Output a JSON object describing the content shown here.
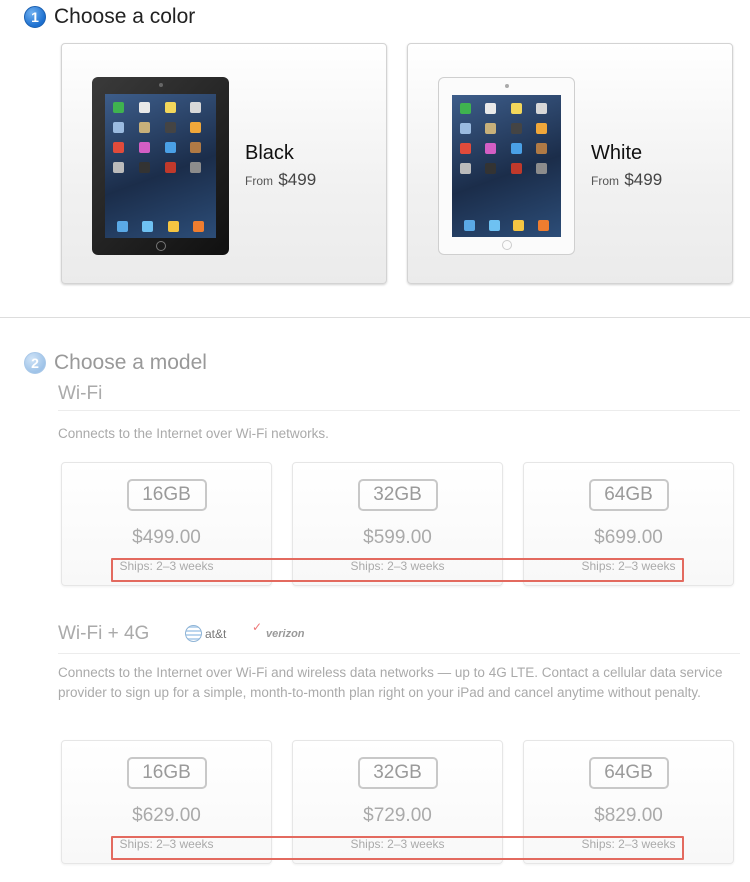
{
  "step1": {
    "number": "1",
    "title": "Choose a color"
  },
  "colors": [
    {
      "name": "Black",
      "from": "From",
      "price": "$499"
    },
    {
      "name": "White",
      "from": "From",
      "price": "$499"
    }
  ],
  "step2": {
    "number": "2",
    "title": "Choose a model"
  },
  "wifi": {
    "title": "Wi-Fi",
    "description": "Connects to the Internet over Wi-Fi networks.",
    "models": [
      {
        "capacity": "16GB",
        "price": "$499.00",
        "ships": "Ships: 2–3 weeks"
      },
      {
        "capacity": "32GB",
        "price": "$599.00",
        "ships": "Ships: 2–3 weeks"
      },
      {
        "capacity": "64GB",
        "price": "$699.00",
        "ships": "Ships: 2–3 weeks"
      }
    ]
  },
  "cellular": {
    "title": "Wi-Fi + 4G",
    "carriers": {
      "att": "at&t",
      "verizon": "verizon"
    },
    "description": "Connects to the Internet over Wi-Fi and wireless data networks — up to 4G LTE. Contact a cellular data service provider to sign up for a simple, month-to-month plan right on your iPad and cancel anytime without penalty.",
    "models": [
      {
        "capacity": "16GB",
        "price": "$629.00",
        "ships": "Ships: 2–3 weeks"
      },
      {
        "capacity": "32GB",
        "price": "$729.00",
        "ships": "Ships: 2–3 weeks"
      },
      {
        "capacity": "64GB",
        "price": "$829.00",
        "ships": "Ships: 2–3 weeks"
      }
    ]
  },
  "colors_palette": {
    "accent_blue": "#1c6fcf",
    "highlight_red": "#e36a5f"
  }
}
